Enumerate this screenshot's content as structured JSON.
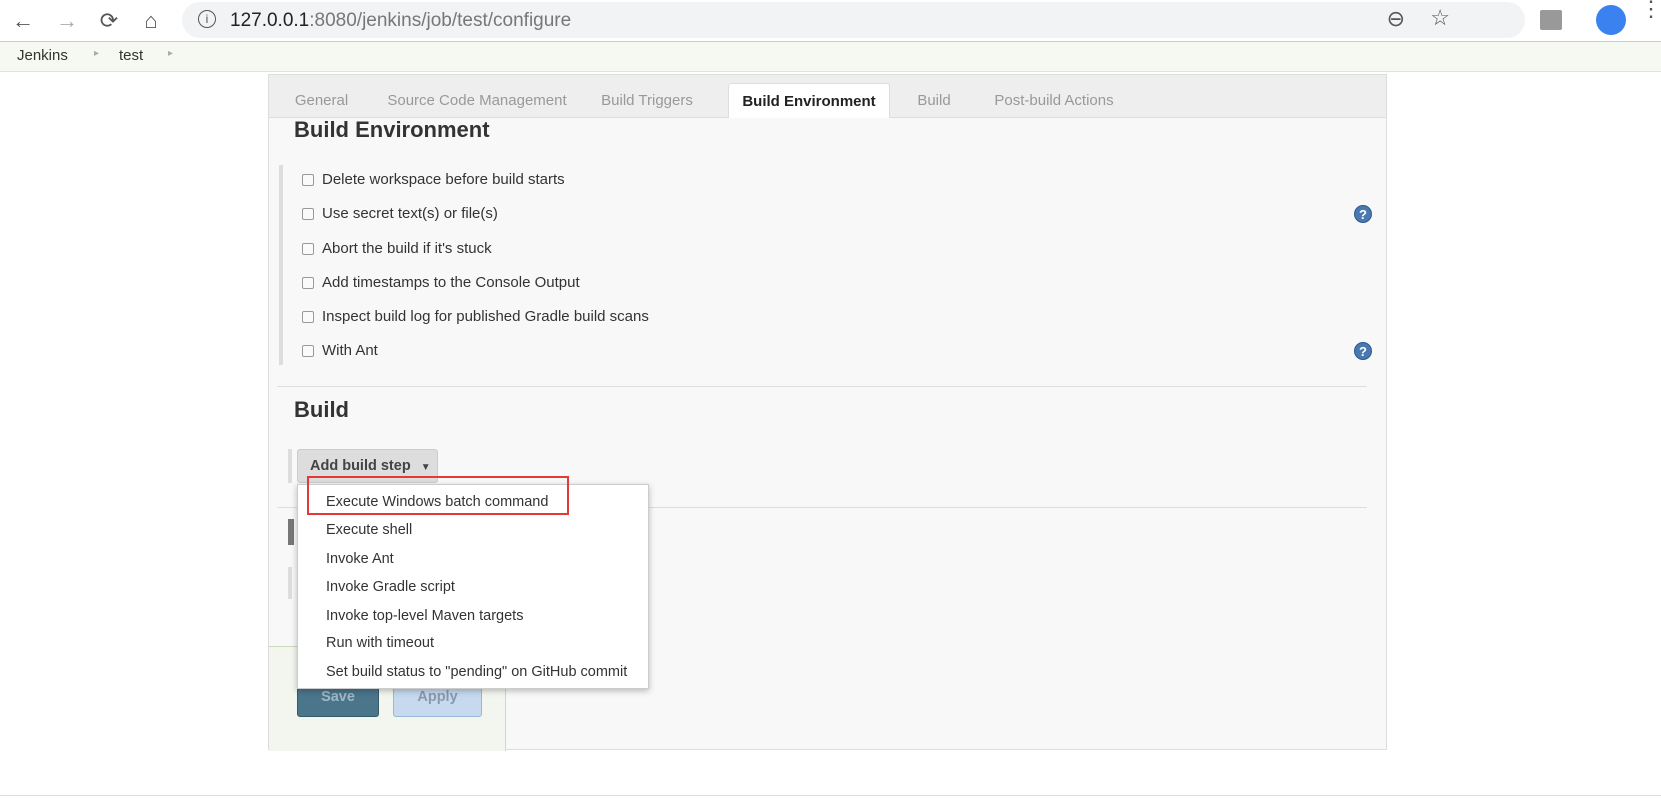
{
  "browser": {
    "url_host": "127.0.0.1",
    "url_path": ":8080/jenkins/job/test/configure"
  },
  "breadcrumb": [
    {
      "label": "Jenkins"
    },
    {
      "label": "test"
    }
  ],
  "tabs": [
    {
      "label": "General"
    },
    {
      "label": "Source Code Management"
    },
    {
      "label": "Build Triggers"
    },
    {
      "label": "Build Environment",
      "active": true
    },
    {
      "label": "Build"
    },
    {
      "label": "Post-build Actions"
    }
  ],
  "build_environment": {
    "title": "Build Environment",
    "options": [
      {
        "label": "Delete workspace before build starts",
        "checked": false
      },
      {
        "label": "Use secret text(s) or file(s)",
        "checked": false,
        "help": true
      },
      {
        "label": "Abort the build if it's stuck",
        "checked": false
      },
      {
        "label": "Add timestamps to the Console Output",
        "checked": false
      },
      {
        "label": "Inspect build log for published Gradle build scans",
        "checked": false
      },
      {
        "label": "With Ant",
        "checked": false,
        "help": true
      }
    ]
  },
  "build": {
    "title": "Build",
    "add_step_label": "Add build step",
    "menu": [
      "Execute Windows batch command",
      "Execute shell",
      "Invoke Ant",
      "Invoke Gradle script",
      "Invoke top-level Maven targets",
      "Run with timeout",
      "Set build status to \"pending\" on GitHub commit"
    ],
    "highlighted": "Execute Windows batch command"
  },
  "actions": {
    "save": "Save",
    "apply": "Apply"
  },
  "colors": {
    "highlight": "#e53935",
    "save": "#4b758b",
    "apply": "#c6d9ee"
  }
}
